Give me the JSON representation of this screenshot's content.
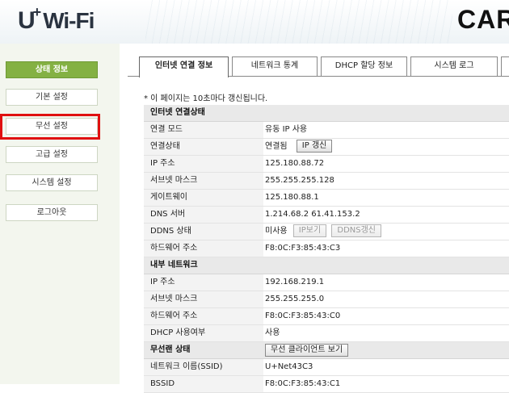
{
  "header": {
    "logo_u": "U",
    "logo_plus": "+",
    "logo_wifi": "Wi-Fi",
    "right_text": "CAR"
  },
  "sidebar": {
    "items": [
      {
        "label": "상태 정보",
        "active": true
      },
      {
        "label": "기본 설정"
      },
      {
        "label": "무선 설정",
        "highlighted": true
      },
      {
        "label": "고급 설정"
      },
      {
        "label": "시스템 설정"
      },
      {
        "label": "로그아웃"
      }
    ]
  },
  "tabs": [
    {
      "label": "인터넷 연결 정보",
      "active": true
    },
    {
      "label": "네트워크 통계"
    },
    {
      "label": "DHCP 할당 정보"
    },
    {
      "label": "시스템 로그"
    }
  ],
  "notice": "* 이 페이지는 10초마다 갱신됩니다.",
  "internet": {
    "title": "인터넷 연결상태",
    "rows": [
      {
        "label": "연결 모드",
        "value": "유동 IP 사용"
      },
      {
        "label": "연결상태",
        "value": "연결됨"
      },
      {
        "label": "IP 주소",
        "value": "125.180.88.72"
      },
      {
        "label": "서브넷 마스크",
        "value": "255.255.255.128"
      },
      {
        "label": "게이트웨이",
        "value": "125.180.88.1"
      },
      {
        "label": "DNS 서버",
        "value": "1.214.68.2 61.41.153.2"
      },
      {
        "label": "DDNS 상태",
        "value": "미사용"
      },
      {
        "label": "하드웨어 주소",
        "value": "F8:0C:F3:85:43:C3"
      }
    ],
    "ip_renew_button": "IP 갱신",
    "ip_view_button": "IP보기",
    "ddns_renew_button": "DDNS갱신"
  },
  "internal": {
    "title": "내부 네트워크",
    "rows": [
      {
        "label": "IP 주소",
        "value": "192.168.219.1"
      },
      {
        "label": "서브넷 마스크",
        "value": "255.255.255.0"
      },
      {
        "label": "하드웨어 주소",
        "value": "F8:0C:F3:85:43:C0"
      },
      {
        "label": "DHCP 사용여부",
        "value": "사용"
      }
    ]
  },
  "wireless": {
    "title": "무선랜 상태",
    "client_button": "무선 클라이언트 보기",
    "rows": [
      {
        "label": "네트워크 이름(SSID)",
        "value": "U+Net43C3"
      },
      {
        "label": "BSSID",
        "value": "F8:0C:F3:85:43:C1"
      }
    ]
  },
  "colors": {
    "active_green": "#84b143",
    "highlight_red": "#e01010"
  }
}
